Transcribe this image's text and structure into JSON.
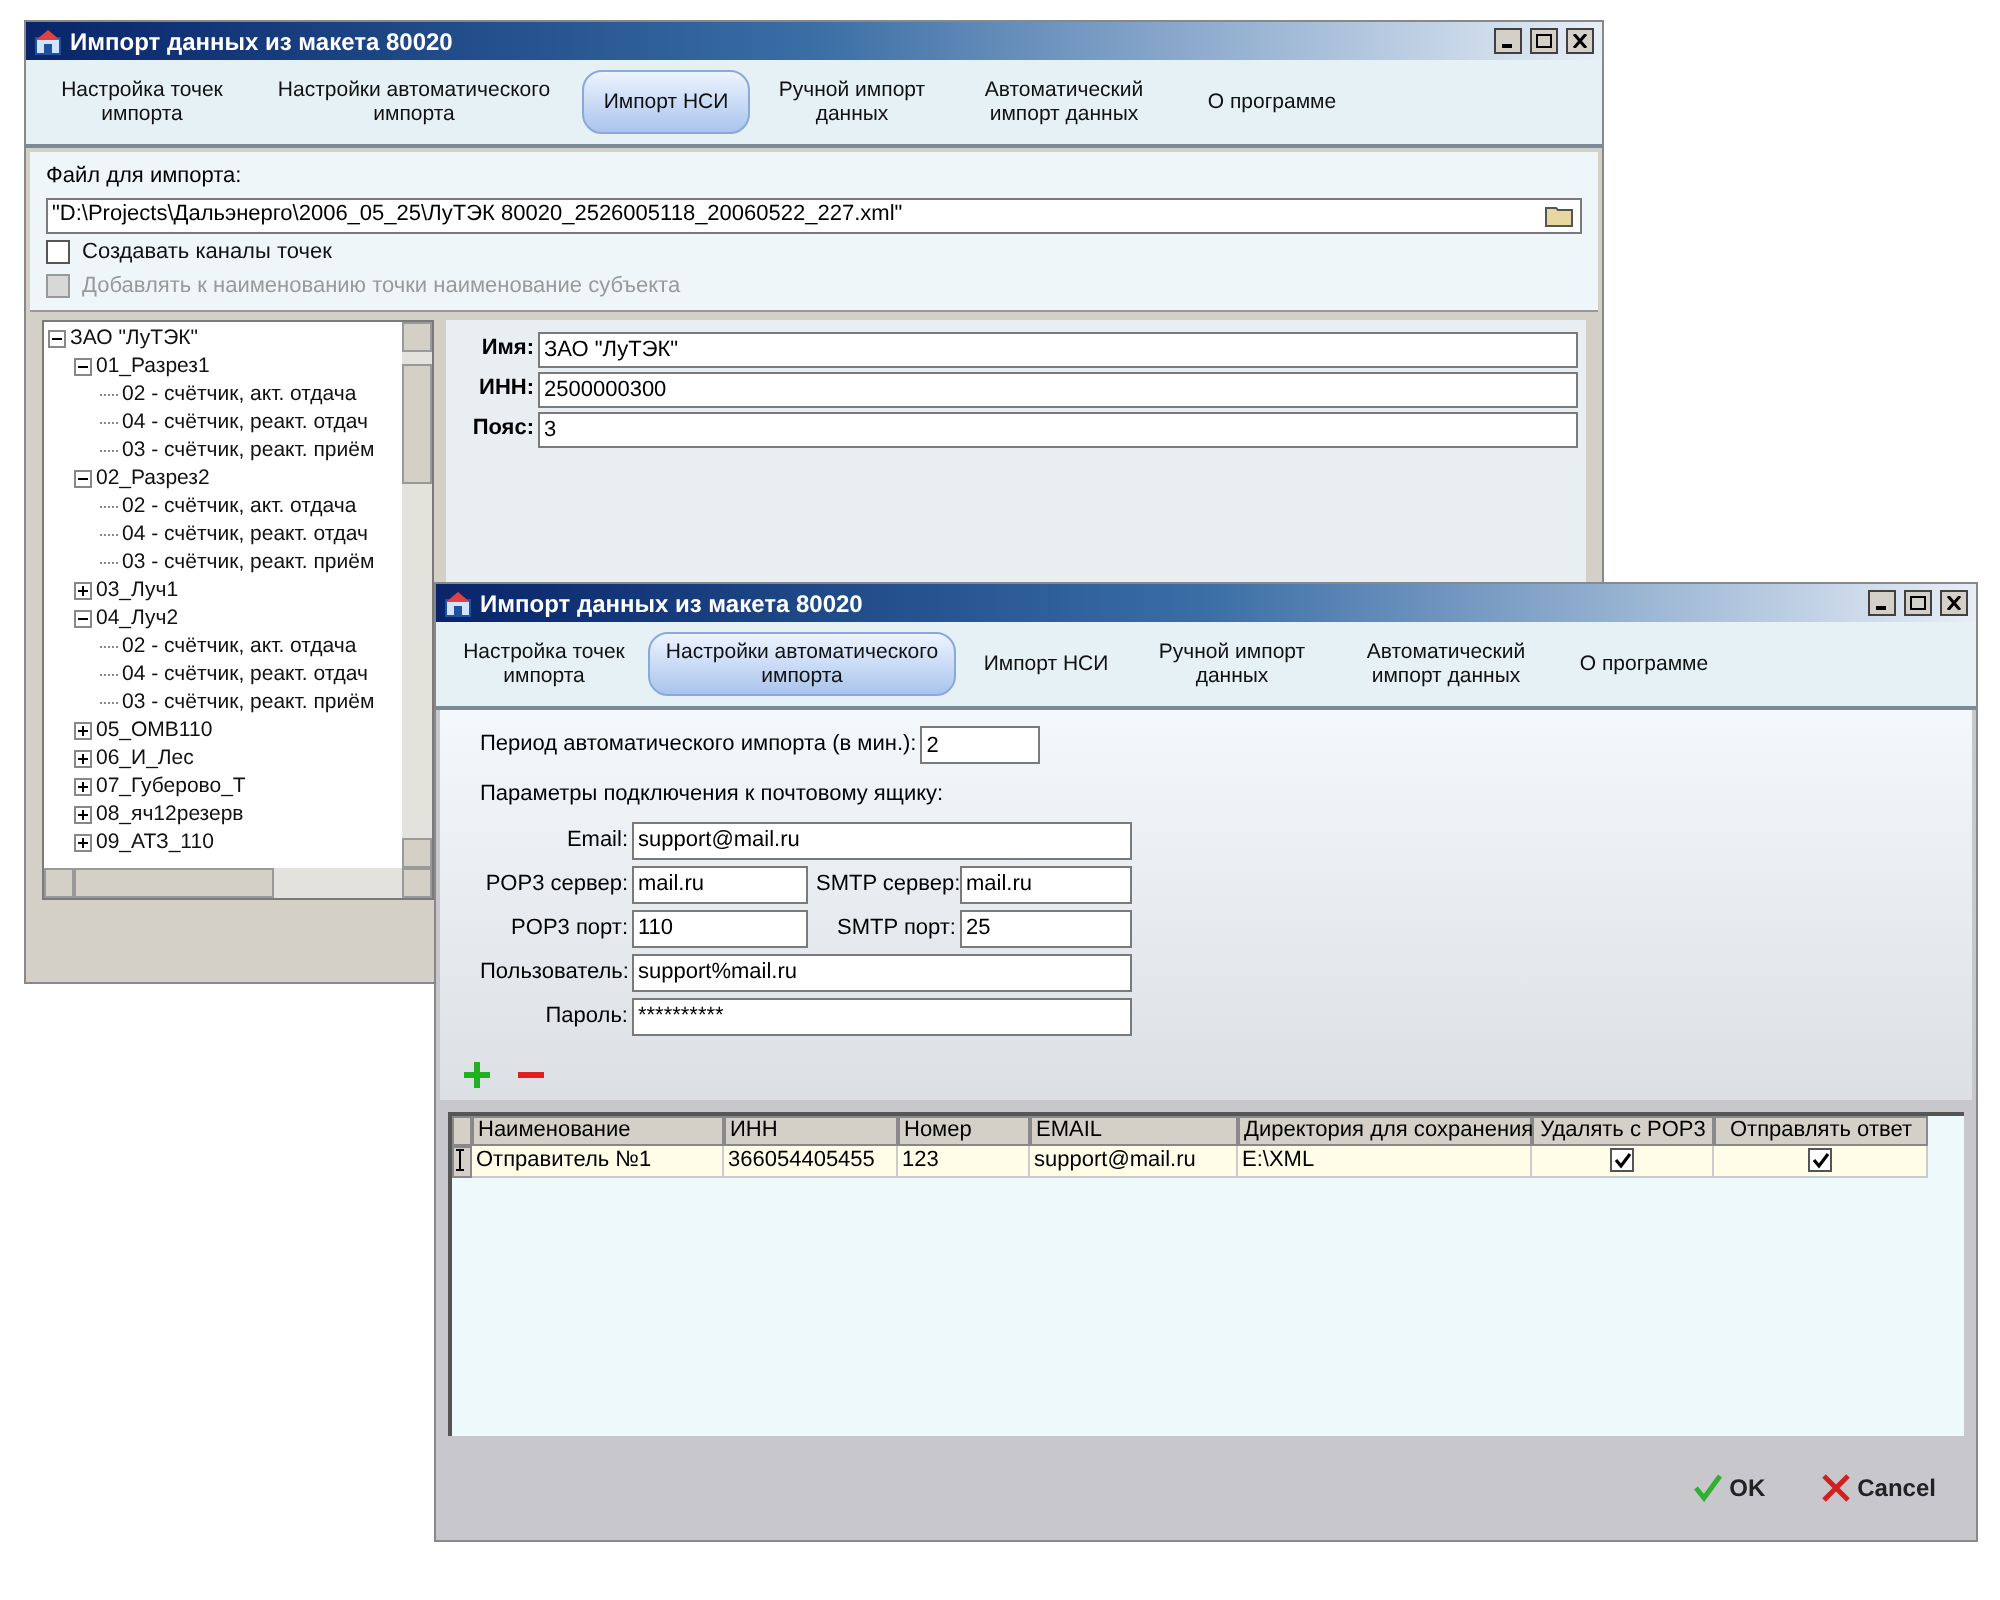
{
  "back_window": {
    "title": "Импорт данных из макета 80020",
    "tabs": [
      {
        "label": "Настройка точек импорта",
        "selected": false
      },
      {
        "label": "Настройки автоматического импорта",
        "selected": false
      },
      {
        "label": "Импорт НСИ",
        "selected": true
      },
      {
        "label": "Ручной импорт данных",
        "selected": false
      },
      {
        "label": "Автоматический импорт данных",
        "selected": false
      },
      {
        "label": "О программе",
        "selected": false
      }
    ],
    "file_label": "Файл для импорта:",
    "file_path": "\"D:\\Projects\\Дальэнерго\\2006_05_25\\ЛуТЭК 80020_2526005118_20060522_227.xml\"",
    "checkboxes": [
      {
        "label": "Создавать каналы точек",
        "checked": false,
        "disabled": false
      },
      {
        "label": "Добавлять к наименованию точки наименование субъекта",
        "checked": false,
        "disabled": true
      }
    ],
    "tree": [
      {
        "label": "ЗАО \"ЛуТЭК\"",
        "expanded": true,
        "children": [
          {
            "label": "01_Разрез1",
            "expanded": true,
            "children": [
              {
                "label": "02 - счётчик, акт. отдача"
              },
              {
                "label": "04 - счётчик, реакт. отдач"
              },
              {
                "label": "03 - счётчик, реакт. приём"
              }
            ]
          },
          {
            "label": "02_Разрез2",
            "expanded": true,
            "children": [
              {
                "label": "02 - счётчик, акт. отдача"
              },
              {
                "label": "04 - счётчик, реакт. отдач"
              },
              {
                "label": "03 - счётчик, реакт. приём"
              }
            ]
          },
          {
            "label": "03_Луч1",
            "expanded": false
          },
          {
            "label": "04_Луч2",
            "expanded": true,
            "children": [
              {
                "label": "02 - счётчик, акт. отдача"
              },
              {
                "label": "04 - счётчик, реакт. отдач"
              },
              {
                "label": "03 - счётчик, реакт. приём"
              }
            ]
          },
          {
            "label": "05_ОМВ110",
            "expanded": false
          },
          {
            "label": "06_И_Лес",
            "expanded": false
          },
          {
            "label": "07_Губерово_Т",
            "expanded": false
          },
          {
            "label": "08_яч12резерв",
            "expanded": false
          },
          {
            "label": "09_АТЗ_110",
            "expanded": false
          }
        ]
      }
    ],
    "fields": [
      {
        "label": "Имя:",
        "value": "ЗАО \"ЛуТЭК\""
      },
      {
        "label": "ИНН:",
        "value": "2500000300"
      },
      {
        "label": "Пояс:",
        "value": "3"
      }
    ]
  },
  "front_window": {
    "title": "Импорт данных из макета 80020",
    "tabs": [
      {
        "label": "Настройка точек импорта",
        "selected": false
      },
      {
        "label": "Настройки автоматического импорта",
        "selected": true
      },
      {
        "label": "Импорт НСИ",
        "selected": false
      },
      {
        "label": "Ручной импорт данных",
        "selected": false
      },
      {
        "label": "Автоматический импорт данных",
        "selected": false
      },
      {
        "label": "О программе",
        "selected": false
      }
    ],
    "period_label": "Период автоматического импорта (в мин.):",
    "period_value": "2",
    "mail_heading": "Параметры подключения к почтовому ящику:",
    "email": {
      "label": "Email:",
      "value": "support@mail.ru"
    },
    "pop3_server": {
      "label": "POP3 сервер:",
      "value": "mail.ru"
    },
    "smtp_server": {
      "label": "SMTP сервер:",
      "value": "mail.ru"
    },
    "pop3_port": {
      "label": "POP3 порт:",
      "value": "110"
    },
    "smtp_port": {
      "label": "SMTP порт:",
      "value": "25"
    },
    "user": {
      "label": "Пользователь:",
      "value": "support%mail.ru"
    },
    "password": {
      "label": "Пароль:",
      "value": "**********"
    },
    "table": {
      "columns": [
        "Наименование",
        "ИНН",
        "Номер",
        "EMAIL",
        "Директория для сохранения",
        "Удалять с POP3",
        "Отправлять ответ"
      ],
      "rows": [
        {
          "cells": [
            "Отправитель №1",
            "366054405455",
            "123",
            "support@mail.ru",
            "E:\\XML"
          ],
          "delete_pop3": true,
          "send_reply": true,
          "selected": true
        }
      ]
    },
    "buttons": [
      "OK",
      "Cancel"
    ]
  }
}
